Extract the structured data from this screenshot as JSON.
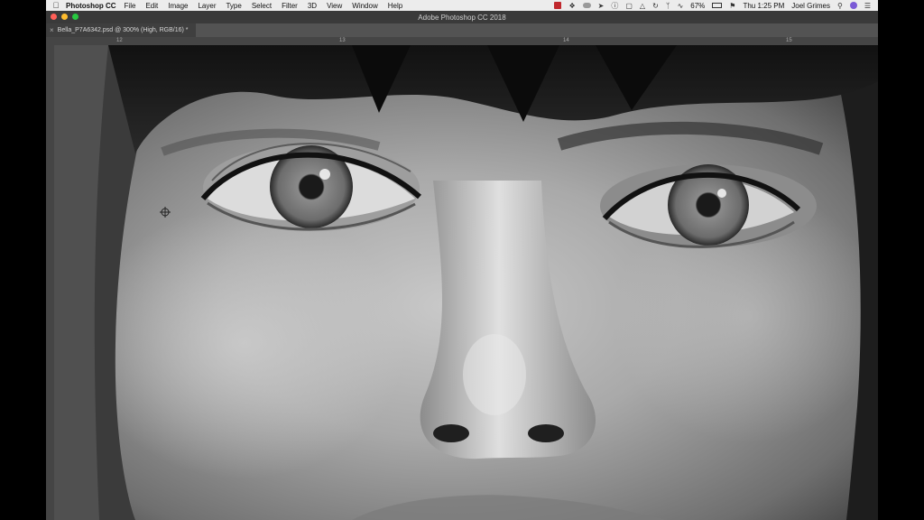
{
  "menubar": {
    "app_name": "Photoshop CC",
    "items": [
      "File",
      "Edit",
      "Image",
      "Layer",
      "Type",
      "Select",
      "Filter",
      "3D",
      "View",
      "Window",
      "Help"
    ],
    "battery": "67%",
    "clock": "Thu 1:25 PM",
    "user": "Joel Grimes"
  },
  "window": {
    "title": "Adobe Photoshop CC 2018"
  },
  "document": {
    "tab_label": "Bella_P7A6342.psd @ 300% (High, RGB/16) *"
  },
  "rulers": {
    "top_labels": [
      "12",
      "13",
      "14",
      "15"
    ]
  },
  "colors": {
    "menubar_bg": "#ececec",
    "app_chrome": "#3a3a3a",
    "tab_bg": "#535353",
    "traffic_close": "#ff5f57",
    "traffic_min": "#febc2e",
    "traffic_max": "#28c840"
  }
}
